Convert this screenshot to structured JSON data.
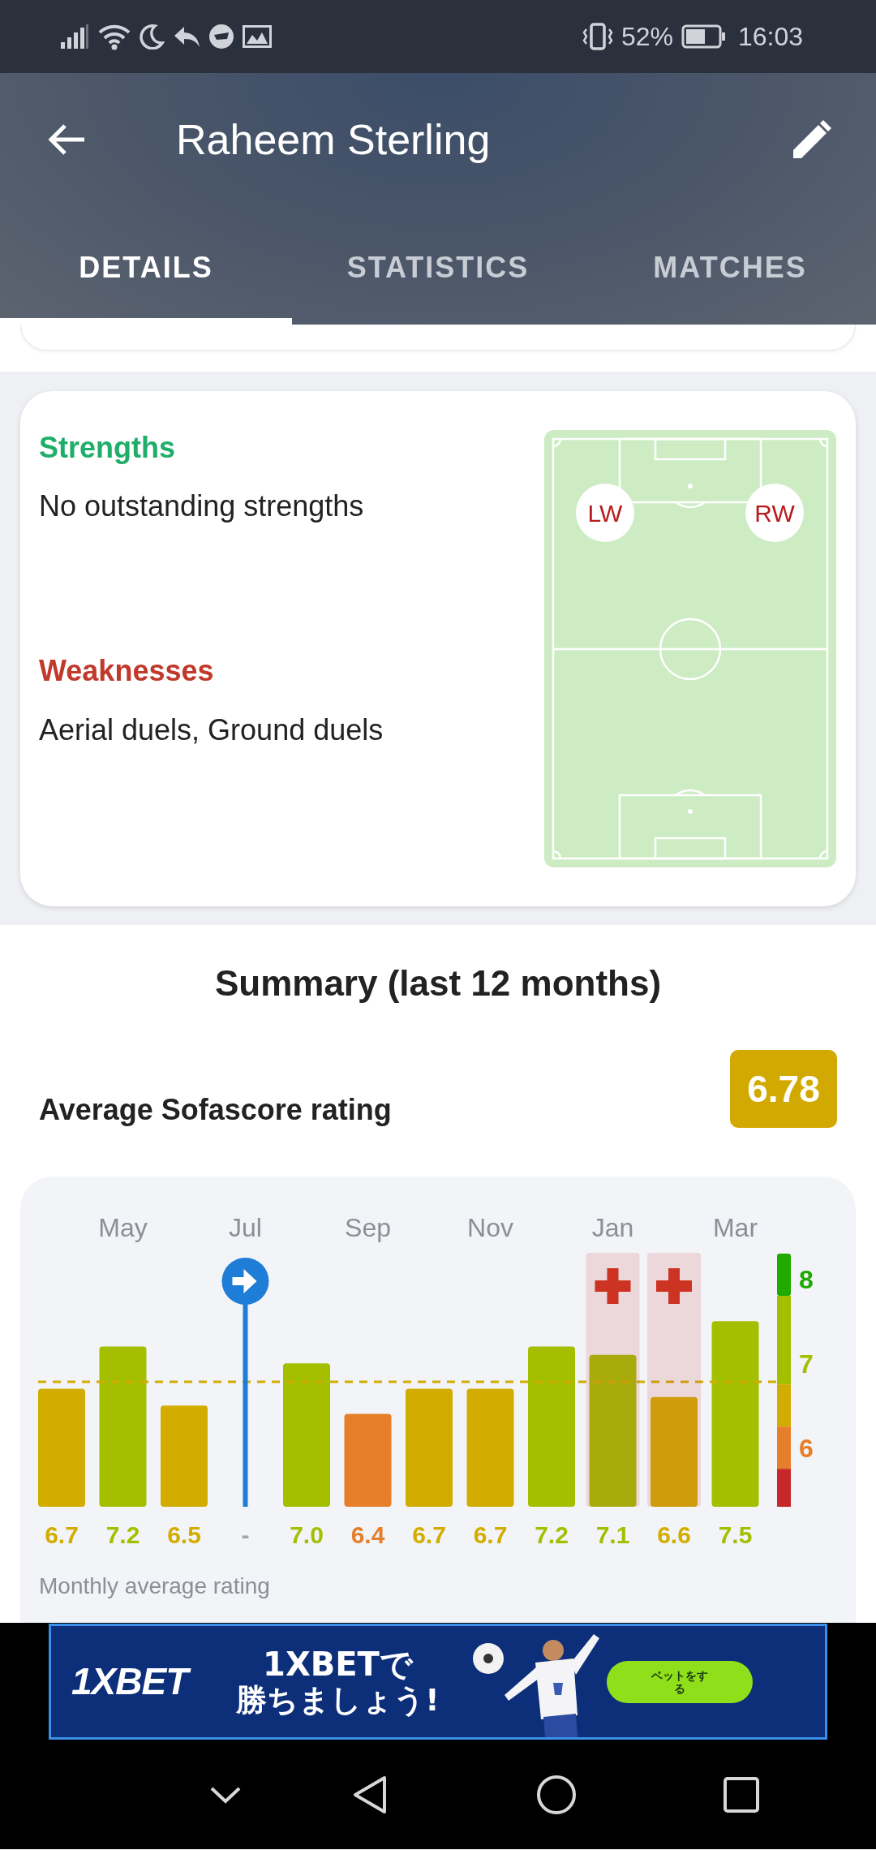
{
  "status_bar": {
    "battery": "52%",
    "time": "16:03"
  },
  "header": {
    "title": "Raheem Sterling"
  },
  "tabs": [
    {
      "label": "DETAILS",
      "selected": true
    },
    {
      "label": "STATISTICS",
      "selected": false
    },
    {
      "label": "MATCHES",
      "selected": false
    }
  ],
  "attributes": {
    "strengths_title": "Strengths",
    "strengths": "No outstanding strengths",
    "weaknesses_title": "Weaknesses",
    "weaknesses": "Aerial duels, Ground duels",
    "positions": [
      {
        "label": "LW"
      },
      {
        "label": "RW"
      }
    ]
  },
  "summary": {
    "title": "Summary (last 12 months)",
    "rating_label": "Average Sofascore rating",
    "rating": "6.78",
    "chart_data": {
      "type": "bar",
      "ylim": [
        5.3,
        8
      ],
      "yticks": [
        6,
        7,
        8
      ],
      "categories": [
        null,
        "May",
        null,
        "Jul",
        null,
        "Sep",
        null,
        "Nov",
        null,
        "Jan",
        null,
        "Mar"
      ],
      "values": [
        6.7,
        7.2,
        6.5,
        null,
        7.0,
        6.4,
        6.7,
        6.7,
        7.2,
        7.1,
        6.6,
        7.5
      ],
      "value_labels": [
        "6.7",
        "7.2",
        "6.5",
        "-",
        "7.0",
        "6.4",
        "6.7",
        "6.7",
        "7.2",
        "7.1",
        "6.6",
        "7.5"
      ],
      "orientation": "vertical"
    },
    "month_flags": [
      {
        "transfer": false,
        "injury": false
      },
      {
        "transfer": false,
        "injury": false
      },
      {
        "transfer": false,
        "injury": false
      },
      {
        "transfer": true,
        "injury": false
      },
      {
        "transfer": false,
        "injury": false
      },
      {
        "transfer": false,
        "injury": false
      },
      {
        "transfer": false,
        "injury": false
      },
      {
        "transfer": false,
        "injury": false
      },
      {
        "transfer": false,
        "injury": false
      },
      {
        "transfer": false,
        "injury": true
      },
      {
        "transfer": false,
        "injury": true
      },
      {
        "transfer": false,
        "injury": false
      }
    ],
    "chart_caption": "Monthly average rating"
  },
  "ad": {
    "logo": "1XBET",
    "headline_1": "1XBETで",
    "headline_2": "勝ちましょう!",
    "button": "ベットをする"
  }
}
